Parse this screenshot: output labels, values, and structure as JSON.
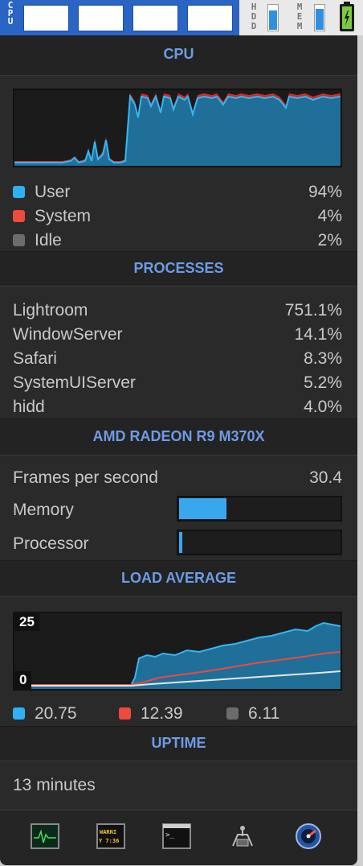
{
  "menubar": {
    "cpu_label": "CPU",
    "hdd_label": "HDD",
    "mem_label": "MEM",
    "hdd_level": 0.75,
    "mem_level": 0.82,
    "battery_icon": "battery-charging-icon"
  },
  "cpu": {
    "title": "CPU",
    "legend": [
      {
        "label": "User",
        "value": "94%",
        "color": "#2fb0f2"
      },
      {
        "label": "System",
        "value": "4%",
        "color": "#ee4a3d"
      },
      {
        "label": "Idle",
        "value": "2%",
        "color": "#6c6c6c"
      }
    ]
  },
  "processes": {
    "title": "PROCESSES",
    "items": [
      {
        "name": "Lightroom",
        "value": "751.1%"
      },
      {
        "name": "WindowServer",
        "value": "14.1%"
      },
      {
        "name": "Safari",
        "value": "8.3%"
      },
      {
        "name": "SystemUIServer",
        "value": "5.2%"
      },
      {
        "name": "hidd",
        "value": "4.0%"
      }
    ]
  },
  "gpu": {
    "title": "AMD RADEON R9 M370X",
    "fps_label": "Frames per second",
    "fps_value": "30.4",
    "memory_label": "Memory",
    "memory_level": 0.29,
    "processor_label": "Processor",
    "processor_level": 0.02
  },
  "load": {
    "title": "LOAD AVERAGE",
    "max_label": "25",
    "min_label": "0",
    "legend": [
      {
        "value": "20.75",
        "color": "#2fb0f2"
      },
      {
        "value": "12.39",
        "color": "#ee4a3d"
      },
      {
        "value": "6.11",
        "color": "#6c6c6c"
      }
    ]
  },
  "uptime": {
    "title": "UPTIME",
    "value": "13 minutes"
  },
  "toolbar": {
    "items": [
      "activity-monitor-icon",
      "console-icon",
      "terminal-icon",
      "system-information-icon",
      "disk-utility-icon"
    ],
    "console_text_1": "WARNI",
    "console_text_2": "Y 7:36",
    "terminal_prompt": ">_"
  }
}
